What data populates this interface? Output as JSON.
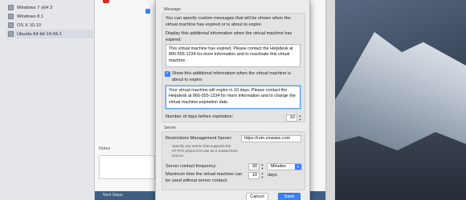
{
  "library": {
    "vms": [
      {
        "label": "Windows 7 x64 3"
      },
      {
        "label": "Windows 8.1"
      },
      {
        "label": "OS X 10.10"
      },
      {
        "label": "Ubuntu 64-bit 14.04.1"
      }
    ],
    "notes_label": "Notes",
    "bottom_button": "Next Steps"
  },
  "sheet": {
    "message_group_title": "Message",
    "intro_text": "You can specify custom messages that will be shown when the virtual machine has expired or is about to expire.",
    "expired_label": "Display this additional information when the virtual machine has expired:",
    "expired_message": "This virtual machine has expired. Please contact the Helpdesk at 866-555-1234 for more information and to reactivate this virtual machine.",
    "about_to_expire_checkbox": "Show this additional information when the virtual machine is about to expire:",
    "about_to_expire_message": "Your virtual machine will expire in 10 days. Please contact the Helpdesk at 866-555-1234 for more information and to change the virtual machine expiration date.",
    "days_before_label": "Number of days before expiration:",
    "days_before_value": "10",
    "server_group_title": "Server",
    "restrictions_server_label": "Restrictions Management Server:",
    "restrictions_server_value": "https://rsm.vmware.com",
    "server_help": "Specify any server that supports the HTTPS protocol to use as a trusted time source.",
    "contact_frequency_label": "Server contact frequency:",
    "contact_frequency_value": "30",
    "contact_frequency_unit": "Minutes",
    "max_time_label": "Maximum time the virtual machine can be used without server contact:",
    "max_time_value": "10",
    "max_time_unit": "days",
    "cancel_label": "Cancel",
    "save_label": "Save"
  },
  "colors": {
    "accent": "#3b82f6",
    "bottom_bar": "#3f5e82"
  }
}
